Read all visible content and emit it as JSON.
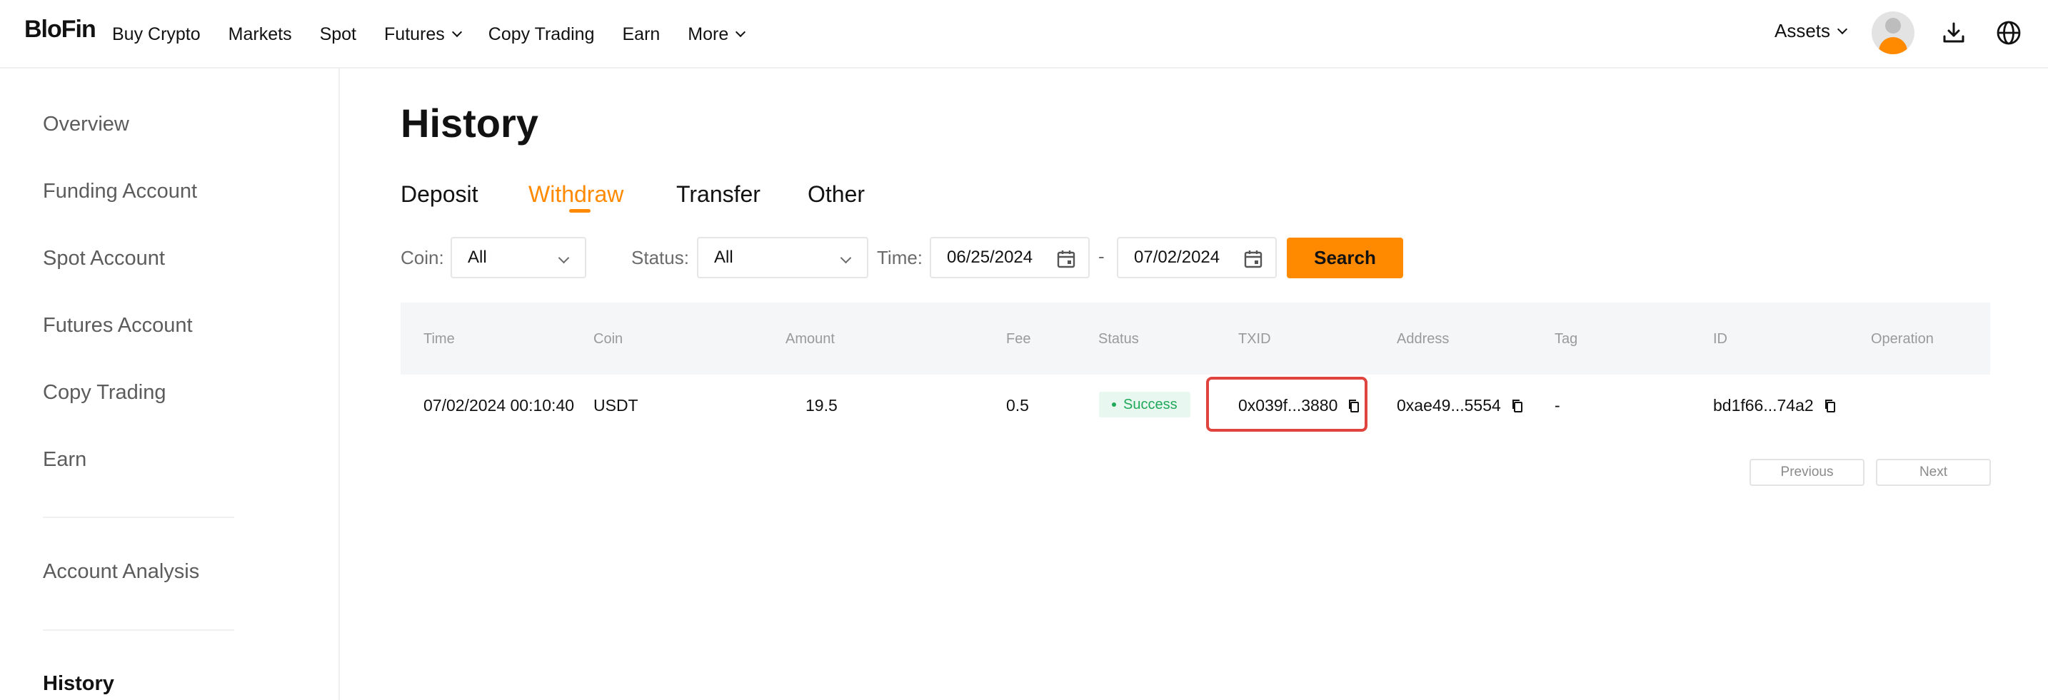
{
  "header": {
    "logo": "BloFin",
    "nav": [
      {
        "label": "Buy Crypto",
        "dropdown": false
      },
      {
        "label": "Markets",
        "dropdown": false
      },
      {
        "label": "Spot",
        "dropdown": false
      },
      {
        "label": "Futures",
        "dropdown": true
      },
      {
        "label": "Copy Trading",
        "dropdown": false
      },
      {
        "label": "Earn",
        "dropdown": false
      },
      {
        "label": "More",
        "dropdown": true
      }
    ],
    "assets_label": "Assets"
  },
  "sidebar": {
    "items": [
      {
        "label": "Overview"
      },
      {
        "label": "Funding Account"
      },
      {
        "label": "Spot Account"
      },
      {
        "label": "Futures Account"
      },
      {
        "label": "Copy Trading"
      },
      {
        "label": "Earn"
      },
      {
        "label": "Account Analysis"
      },
      {
        "label": "History"
      }
    ],
    "active": "History"
  },
  "main": {
    "title": "History",
    "tabs": [
      {
        "label": "Deposit"
      },
      {
        "label": "Withdraw"
      },
      {
        "label": "Transfer"
      },
      {
        "label": "Other"
      }
    ],
    "active_tab": "Withdraw",
    "filters": {
      "coin_label": "Coin:",
      "coin_value": "All",
      "status_label": "Status:",
      "status_value": "All",
      "time_label": "Time:",
      "start_date": "06/25/2024",
      "separator": "-",
      "end_date": "07/02/2024",
      "search_label": "Search"
    },
    "table": {
      "columns": [
        "Time",
        "Coin",
        "Amount",
        "Fee",
        "Status",
        "TXID",
        "Address",
        "Tag",
        "ID",
        "Operation"
      ],
      "rows": [
        {
          "time": "07/02/2024 00:10:40",
          "coin": "USDT",
          "amount": "19.5",
          "fee": "0.5",
          "status": "Success",
          "txid": "0x039f...3880",
          "address": "0xae49...5554",
          "tag": "-",
          "id": "bd1f66...74a2",
          "operation": ""
        }
      ]
    },
    "pagination": {
      "previous_label": "Previous",
      "next_label": "Next"
    }
  },
  "colors": {
    "accent": "#ff8a00",
    "success": "#1fa85a",
    "highlight": "#e0443e"
  }
}
